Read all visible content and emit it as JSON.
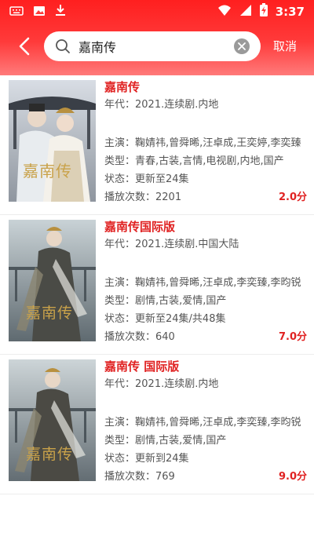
{
  "status_bar": {
    "time": "3:37"
  },
  "search": {
    "value": "嘉南传",
    "cancel_label": "取消"
  },
  "colors": {
    "accent": "#ff2a2a",
    "title_red": "#e02222"
  },
  "results": [
    {
      "title": "嘉南传",
      "year_line": "年代：2021.连续剧.内地",
      "cast_line": "主演：鞠婧祎,曾舜晞,汪卓成,王奕婷,李奕臻",
      "genre_line": "类型：青春,古装,言情,电视剧,内地,国产",
      "status_line": "状态：更新至24集",
      "plays_line": "播放次数：2201",
      "score": "2.0分",
      "poster_text": "嘉南传"
    },
    {
      "title": "嘉南传国际版",
      "year_line": "年代：2021.连续剧.中国大陆",
      "cast_line": "主演：鞠婧祎,曾舜晞,汪卓成,李奕臻,李昀锐",
      "genre_line": "类型：剧情,古装,爱情,国产",
      "status_line": "状态：更新至24集/共48集",
      "plays_line": "播放次数：640",
      "score": "7.0分",
      "poster_text": "嘉南传"
    },
    {
      "title": "嘉南传 国际版",
      "year_line": "年代：2021.连续剧.内地",
      "cast_line": "主演：鞠婧祎,曾舜晞,汪卓成,李奕臻,李昀锐",
      "genre_line": "类型：剧情,古装,爱情,国产",
      "status_line": "状态：更新到24集",
      "plays_line": "播放次数：769",
      "score": "9.0分",
      "poster_text": "嘉南传"
    }
  ]
}
